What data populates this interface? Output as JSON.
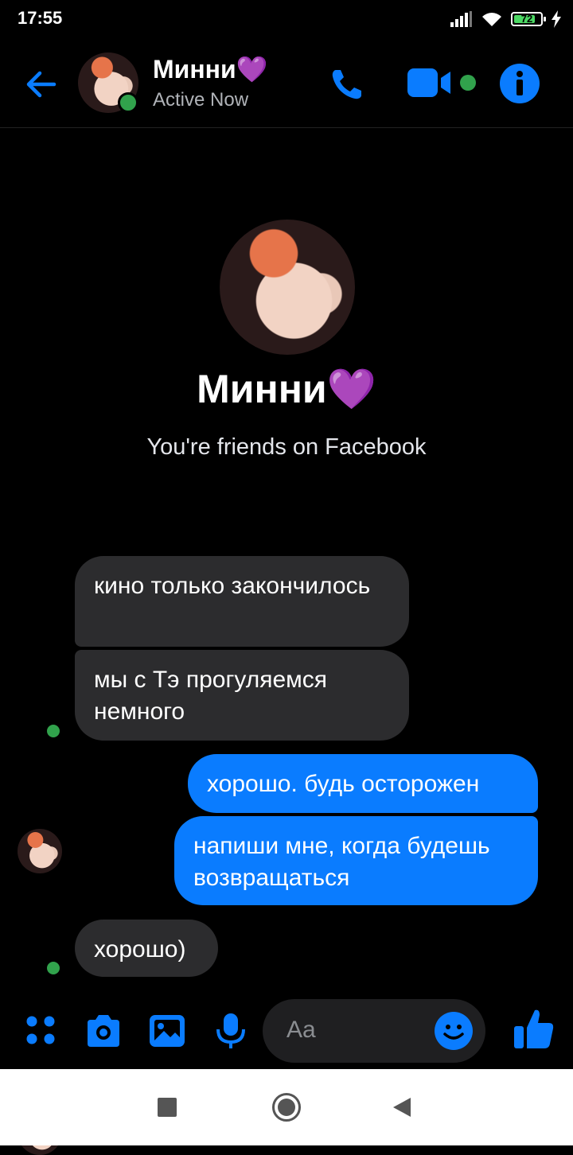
{
  "status_bar": {
    "time": "17:55",
    "battery": "72",
    "battery_level": 0.72
  },
  "header": {
    "name": "Минни💜",
    "status": "Active Now",
    "icons": [
      "back-arrow-icon",
      "phone-icon",
      "video-camera-icon",
      "info-icon"
    ],
    "accent_color": "#0a7cff",
    "online_color": "#31a24c"
  },
  "profile": {
    "name": "Минни💜",
    "subtitle": "You're friends on Facebook"
  },
  "messages": [
    {
      "direction": "incoming",
      "text": "кино только закончилось"
    },
    {
      "direction": "incoming",
      "text": "мы с Тэ прогуляемся немного"
    },
    {
      "direction": "outgoing",
      "text": "хорошо. будь осторожен"
    },
    {
      "direction": "outgoing",
      "text": "напиши мне, когда будешь возвращаться"
    },
    {
      "direction": "incoming",
      "text": "хорошо)"
    }
  ],
  "composer": {
    "placeholder": "Aa",
    "icons": [
      "menu-dots-icon",
      "camera-icon",
      "gallery-icon",
      "microphone-icon",
      "emoji-icon",
      "thumbs-up-icon"
    ]
  },
  "navbar": {
    "icons": [
      "recents-square-icon",
      "home-circle-icon",
      "back-triangle-icon"
    ]
  }
}
